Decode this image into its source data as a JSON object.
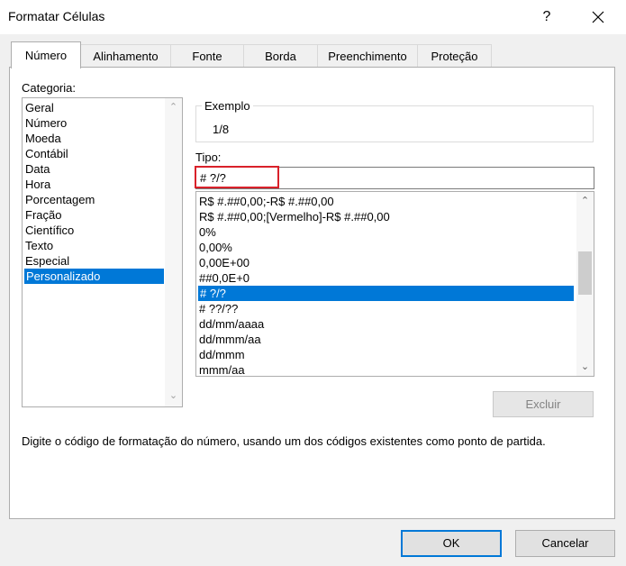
{
  "window": {
    "title": "Formatar Células",
    "help_glyph": "?",
    "close_icon": "close-icon"
  },
  "tabs": [
    {
      "label": "Número",
      "active": true
    },
    {
      "label": "Alinhamento"
    },
    {
      "label": "Fonte"
    },
    {
      "label": "Borda"
    },
    {
      "label": "Preenchimento"
    },
    {
      "label": "Proteção"
    }
  ],
  "categoria": {
    "label": "Categoria:",
    "items": [
      "Geral",
      "Número",
      "Moeda",
      "Contábil",
      "Data",
      "Hora",
      "Porcentagem",
      "Fração",
      "Científico",
      "Texto",
      "Especial",
      "Personalizado"
    ],
    "selected": "Personalizado"
  },
  "exemplo": {
    "label": "Exemplo",
    "value": "1/8"
  },
  "tipo": {
    "label": "Tipo:",
    "value": "# ?/?",
    "highlight_color": "#d9212a",
    "formats": [
      "R$ #.##0,00;-R$ #.##0,00",
      "R$ #.##0,00;[Vermelho]-R$ #.##0,00",
      "0%",
      "0,00%",
      "0,00E+00",
      "##0,0E+0",
      "# ?/?",
      "# ??/??",
      "dd/mm/aaaa",
      "dd/mmm/aa",
      "dd/mmm",
      "mmm/aa"
    ],
    "selected": "# ?/?"
  },
  "buttons": {
    "excluir": "Excluir",
    "ok": "OK",
    "cancelar": "Cancelar"
  },
  "description": "Digite o código de formatação do número, usando um dos códigos existentes como ponto de partida.",
  "colors": {
    "selection": "#0078d7",
    "ok_border": "#0078d7"
  }
}
